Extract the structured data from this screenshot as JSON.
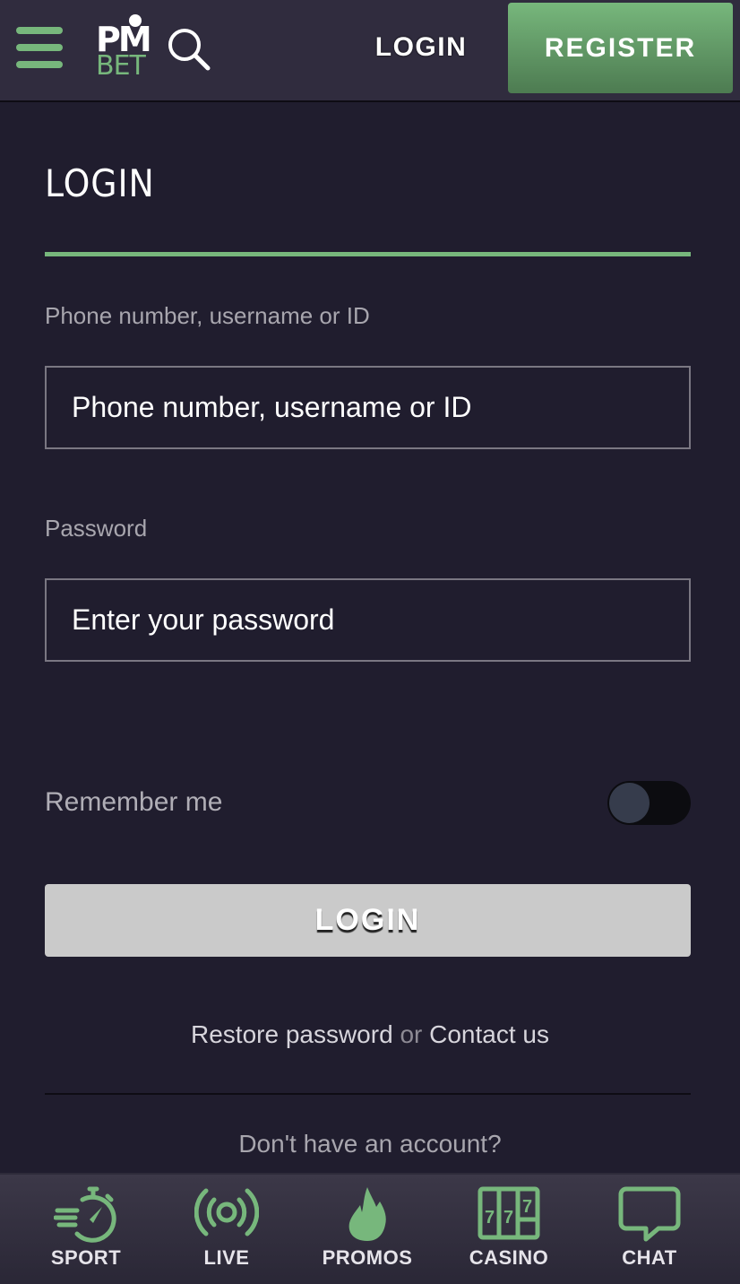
{
  "header": {
    "menu_icon": "hamburger-menu-icon",
    "logo": {
      "top": "PM",
      "bottom": "BET"
    },
    "search_icon": "search-icon",
    "login_label": "LOGIN",
    "register_label": "REGISTER"
  },
  "form": {
    "title": "LOGIN",
    "username": {
      "label": "Phone number, username or ID",
      "placeholder": "Phone number, username or ID",
      "value": ""
    },
    "password": {
      "label": "Password",
      "placeholder": "Enter your password",
      "value": ""
    },
    "remember_me": {
      "label": "Remember me",
      "checked": false
    },
    "submit_label": "LOGIN",
    "restore_link": "Restore password",
    "or_text": "or",
    "contact_link": "Contact us",
    "no_account_text": "Don't have an account?"
  },
  "bottom_nav": {
    "items": [
      {
        "label": "SPORT",
        "icon": "stopwatch-icon"
      },
      {
        "label": "LIVE",
        "icon": "live-broadcast-icon"
      },
      {
        "label": "PROMOS",
        "icon": "flame-icon"
      },
      {
        "label": "CASINO",
        "icon": "slot-machine-icon"
      },
      {
        "label": "CHAT",
        "icon": "chat-bubble-icon"
      }
    ]
  },
  "colors": {
    "accent": "#77b77c",
    "background": "#201d2e",
    "header": "#302c3e",
    "login_button": "#cacaca"
  }
}
